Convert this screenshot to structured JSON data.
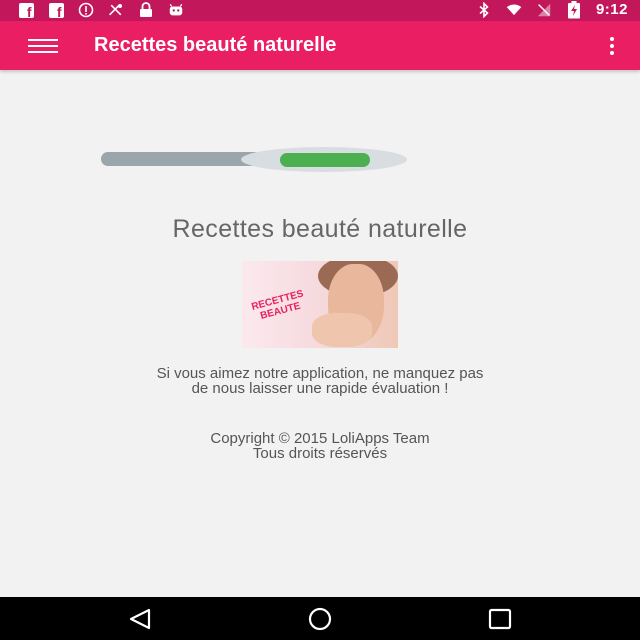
{
  "status_bar": {
    "time": "9:12",
    "left_icons": [
      "facebook-icon",
      "facebook-icon",
      "info-circle-icon",
      "no-signal-tools-icon",
      "lock-icon",
      "android-icon"
    ],
    "right_icons": [
      "bluetooth-icon",
      "wifi-icon",
      "no-sim-icon",
      "battery-charging-icon"
    ]
  },
  "app_bar": {
    "title": "Recettes beauté naturelle",
    "menu_icon": "hamburger-menu-icon",
    "overflow_icon": "more-vert-icon"
  },
  "content": {
    "toggle_state": "on",
    "title": "Recettes beauté naturelle",
    "image_stamp_line1": "RECETTES",
    "image_stamp_line2": "BEAUTE",
    "rate_line1": "Si vous aimez notre application, ne manquez pas",
    "rate_line2": "de nous laisser une rapide évaluation !",
    "copyright_line1": "Copyright © 2015 LoliApps Team",
    "copyright_line2": "Tous droits réservés"
  },
  "nav_bar": {
    "buttons": [
      "back-icon",
      "home-icon",
      "recents-icon"
    ]
  },
  "colors": {
    "status_bar": "#c2185b",
    "app_bar": "#e91e63",
    "toggle_green": "#4caf50",
    "background": "#f2f2f2"
  }
}
